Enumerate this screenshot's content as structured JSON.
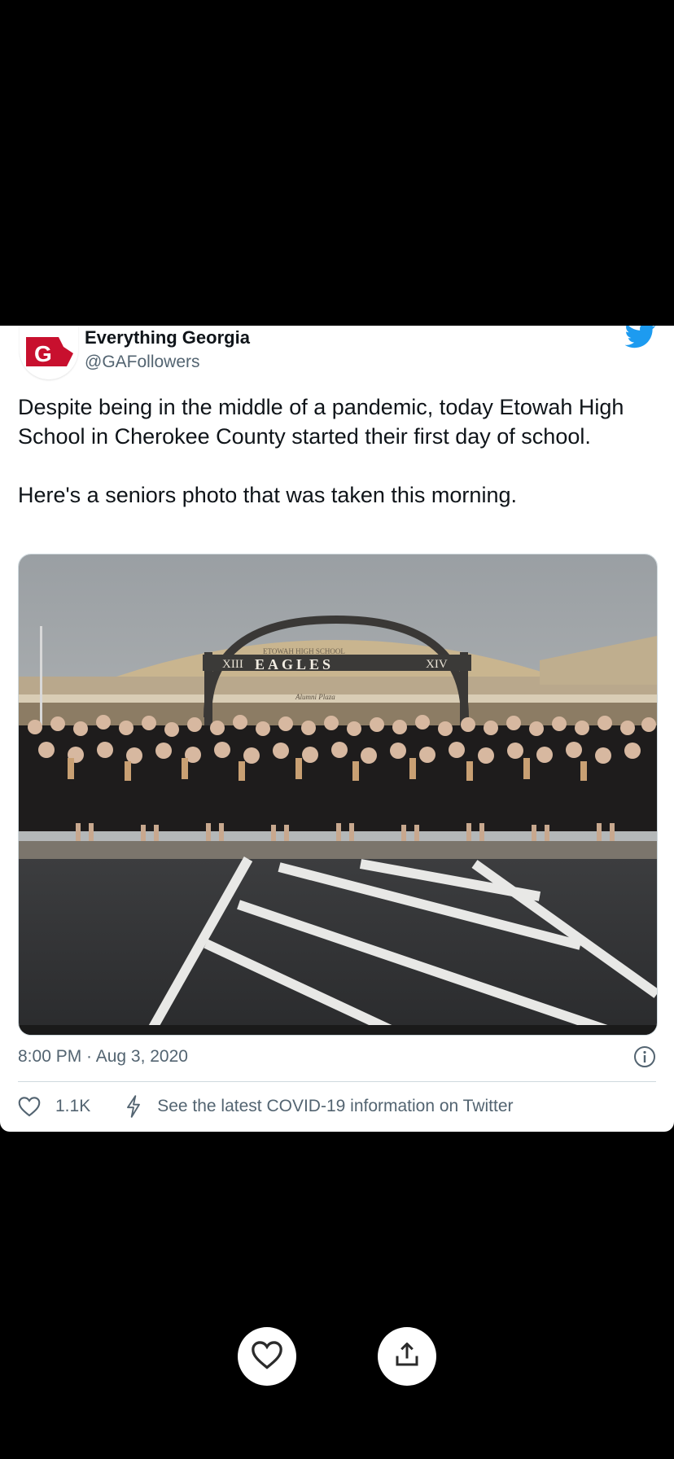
{
  "account": {
    "display_name": "Everything Georgia",
    "handle": "@GAFollowers",
    "avatar_letter": "G"
  },
  "tweet": {
    "text": "Despite being in the middle of a pandemic, today Etowah High School in Cherokee County started their first day of school.\n\nHere's a seniors photo that was taken this morning.",
    "photo": {
      "sign_upper": "ETOWAH HIGH SCHOOL",
      "sign_left": "XIII",
      "sign_main": "EAGLES",
      "sign_right": "XIV",
      "sign_lower": "Alumni Plaza"
    },
    "timestamp": "8:00 PM · Aug 3, 2020",
    "like_count": "1.1K",
    "covid_notice": "See the latest COVID-19 information on Twitter"
  },
  "colors": {
    "brand": "#1d9bf0",
    "avatar_red": "#c8102e",
    "text_primary": "#0f1419",
    "text_secondary": "#536471"
  },
  "icons": [
    "twitter-bird-icon",
    "info-icon",
    "heart-icon",
    "bolt-icon",
    "share-icon"
  ]
}
